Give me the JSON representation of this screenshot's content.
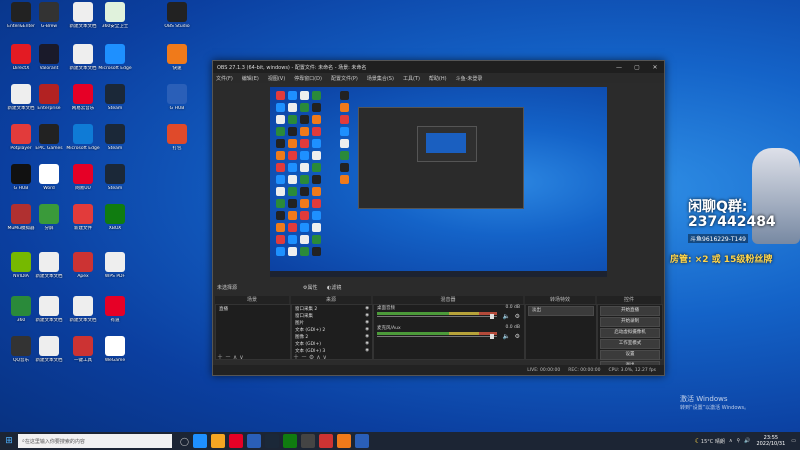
{
  "desktop": {
    "icons": [
      {
        "label": "Enter&Enter",
        "color": "#222"
      },
      {
        "label": "G-Brew",
        "color": "#333"
      },
      {
        "label": "新建文本文档",
        "color": "#eee"
      },
      {
        "label": "360安全卫士",
        "color": "#e0f2dc"
      },
      {
        "label": "DirectX",
        "color": "#e31b23"
      },
      {
        "label": "Valorant",
        "color": "#1a1a2a"
      },
      {
        "label": "新建文本文档",
        "color": "#eee"
      },
      {
        "label": "Microsoft Edge",
        "color": "#1e90ff"
      },
      {
        "label": "新建文本文档",
        "color": "#eee"
      },
      {
        "label": "Enterprise",
        "color": "#b22222"
      },
      {
        "label": "网易云音乐",
        "color": "#e60026"
      },
      {
        "label": "Steam",
        "color": "#1b2838"
      },
      {
        "label": "Potplayer",
        "color": "#e23b3b"
      },
      {
        "label": "EPIC Games",
        "color": "#222"
      },
      {
        "label": "Microsoft Edge",
        "color": "#0f7bd6"
      },
      {
        "label": "Steam",
        "color": "#1b2838"
      },
      {
        "label": "G HUB",
        "color": "#111"
      },
      {
        "label": "Word",
        "color": "#fff"
      },
      {
        "label": "网易UU",
        "color": "#e60026"
      },
      {
        "label": "Steam",
        "color": "#1b2838"
      },
      {
        "label": "MuMu模拟器",
        "color": "#b03030"
      },
      {
        "label": "分屏",
        "color": "#3a9a3a"
      },
      {
        "label": "新建文件",
        "color": "#e23b3b"
      },
      {
        "label": "XBOX",
        "color": "#107c10"
      },
      {
        "label": "NVIDIA",
        "color": "#76b900"
      },
      {
        "label": "新建文本文档",
        "color": "#eee"
      },
      {
        "label": "Apex",
        "color": "#c33"
      },
      {
        "label": "WPS PDF",
        "color": "#eee"
      },
      {
        "label": "360",
        "color": "#2a8a3a"
      },
      {
        "label": "新建文本文档",
        "color": "#eee"
      },
      {
        "label": "新建文本文档",
        "color": "#eee"
      },
      {
        "label": "有道",
        "color": "#e60026"
      },
      {
        "label": "QQ音乐",
        "color": "#333"
      },
      {
        "label": "新建文本文档",
        "color": "#eee"
      },
      {
        "label": "一键工具",
        "color": "#c33"
      },
      {
        "label": "WeGame",
        "color": "#fff"
      },
      {
        "label": "OBS Studio",
        "color": "#222"
      },
      {
        "label": "快速",
        "color": "#f07a1a"
      },
      {
        "label": "G HUB",
        "color": "#2a5fb8"
      },
      {
        "label": "打包",
        "color": "#e04a2a"
      }
    ]
  },
  "obs": {
    "title": "OBS 27.1.3 (64-bit, windows) - 配置文件: 未命名 - 场景: 未命名",
    "menu": [
      "文件(F)",
      "编辑(E)",
      "视图(V)",
      "停靠窗口(D)",
      "配置文件(P)",
      "场景集合(S)",
      "工具(T)",
      "帮助(H)",
      "斗鱼-未登录"
    ],
    "no_source_label": "未选择源",
    "props_label": "属性",
    "filters_label": "滤镜",
    "panels": {
      "scenes": "场景",
      "sources": "来源",
      "mixer": "混音器",
      "transitions": "转场特效",
      "controls": "控件"
    },
    "scene_items": [
      "直播"
    ],
    "source_items": [
      "窗口采集 2",
      "窗口采集",
      "图片",
      "文本 (GDI+) 2",
      "图像 2",
      "文本 (GDI+)",
      "文本 (GDI+) 3"
    ],
    "mixer": [
      {
        "name": "桌面音频",
        "db": "0.0 dB"
      },
      {
        "name": "麦克风/Aux",
        "db": "0.0 dB"
      }
    ],
    "transition": "淡出",
    "controls": [
      "开始直播",
      "开始录制",
      "启动虚拟摄像机",
      "工作室模式",
      "设置",
      "退出"
    ],
    "status": {
      "live": "LIVE: 00:00:00",
      "rec": "REC: 00:00:00",
      "cpu": "CPU: 3.0%, 12.27 fps"
    }
  },
  "overlay": {
    "qq_group_label": "闲聊Q群:",
    "qq_number": "237442484",
    "douyin_id": "斗鱼9616229-T149",
    "promo": "房管: ×2 或 15级粉丝牌"
  },
  "taskbar": {
    "search_placeholder": "在这里输入你要搜索的内容",
    "weather": "15°C 晴朗",
    "time": "23:55",
    "date": "2022/10/31",
    "apps": [
      {
        "color": "#1e90ff"
      },
      {
        "color": "#f5a623"
      },
      {
        "color": "#e60026"
      },
      {
        "color": "#2a5fb8"
      },
      {
        "color": "#1b2838"
      },
      {
        "color": "#107c10"
      },
      {
        "color": "#444"
      },
      {
        "color": "#c33"
      },
      {
        "color": "#f07a1a"
      },
      {
        "color": "#2a5fb8"
      }
    ]
  },
  "watermark": {
    "line1": "激活 Windows",
    "line2": "转到“设置”以激活 Windows。"
  }
}
